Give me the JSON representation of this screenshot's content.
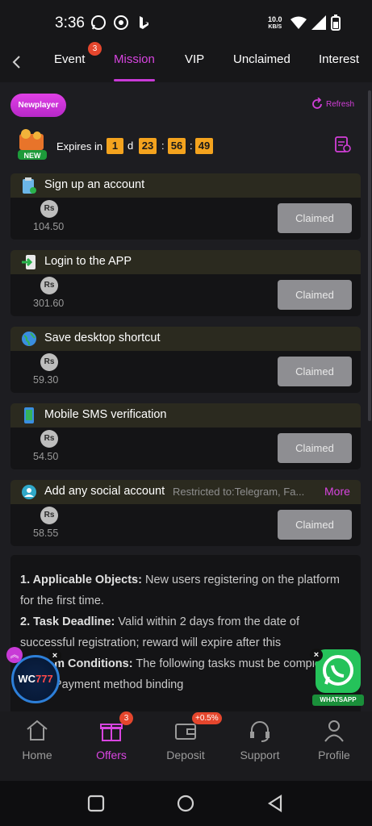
{
  "status_bar": {
    "time": "3:36",
    "net_speed_value": "10.0",
    "net_speed_unit": "KB/S"
  },
  "tabs": [
    {
      "label": "Event",
      "badge": "3"
    },
    {
      "label": "Mission",
      "active": true
    },
    {
      "label": "VIP"
    },
    {
      "label": "Unclaimed"
    },
    {
      "label": "Interest"
    }
  ],
  "header": {
    "newplayer_label": "Newplayer",
    "refresh_label": "Refresh",
    "new_badge": "NEW"
  },
  "countdown": {
    "label": "Expires in",
    "days": "1",
    "days_unit": "d",
    "hours": "23",
    "minutes": "56",
    "seconds": "49",
    "separator": ":"
  },
  "tasks": [
    {
      "title": "Sign up an account",
      "currency": "Rs",
      "amount": "104.50",
      "button": "Claimed",
      "icon": "clipboard-icon"
    },
    {
      "title": "Login to the APP",
      "currency": "Rs",
      "amount": "301.60",
      "button": "Claimed",
      "icon": "login-icon"
    },
    {
      "title": "Save desktop shortcut",
      "currency": "Rs",
      "amount": "59.30",
      "button": "Claimed",
      "icon": "globe-icon"
    },
    {
      "title": "Mobile SMS verification",
      "currency": "Rs",
      "amount": "54.50",
      "button": "Claimed",
      "icon": "phone-icon"
    },
    {
      "title": "Add any social account",
      "restriction": "Restricted to:Telegram, Fa...",
      "more": "More",
      "currency": "Rs",
      "amount": "58.55",
      "button": "Claimed",
      "icon": "social-icon"
    }
  ],
  "rules": {
    "r1_head": "1. Applicable Objects:",
    "r1_text": " New users registering on the platform for the first time.",
    "r2_head": "2. Task Deadline:",
    "r2_text": " Valid within 2 days from the date of successful registration; reward will expire after this",
    "r3_head": "...m Conditions:",
    "r3_text": " The following tasks must be completed to claim: Payment method binding"
  },
  "floating": {
    "wc_left": "WC",
    "wc_right": "777",
    "whatsapp_label": "WHATSAPP",
    "close": "×"
  },
  "bottom_nav": [
    {
      "label": "Home"
    },
    {
      "label": "Offers",
      "active": true,
      "badge": "3"
    },
    {
      "label": "Deposit",
      "pill": "+0.5%"
    },
    {
      "label": "Support"
    },
    {
      "label": "Profile"
    }
  ],
  "colors": {
    "accent": "#d845e0",
    "timer": "#f4a31e",
    "claimed": "#8e8e92",
    "badge": "#e5462d"
  }
}
